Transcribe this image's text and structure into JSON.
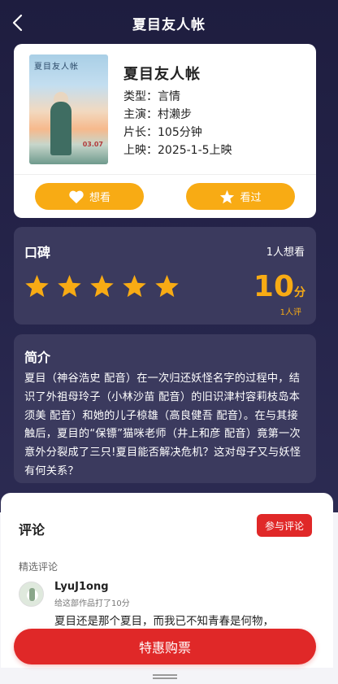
{
  "header": {
    "title": "夏目友人帐"
  },
  "movie": {
    "poster_title": "夏目友人帐",
    "poster_date": "03.07",
    "name": "夏目友人帐",
    "genre": "类型：言情",
    "cast": "主演：村濑步",
    "duration": "片长：105分钟",
    "release": "上映：2025-1-5上映"
  },
  "actions": {
    "want_label": "想看",
    "seen_label": "看过"
  },
  "rating": {
    "label": "口碑",
    "want_count": "1人想看",
    "stars_filled": 5,
    "stars_total": 5,
    "score": "10",
    "score_unit": "分",
    "rater_count": "1人评"
  },
  "intro": {
    "title": "简介",
    "text": "夏目（神谷浩史 配音）在一次归还妖怪名字的过程中，结识了外祖母玲子（小林沙苗 配音）的旧识津村容莉枝岛本须美 配音）和她的儿子椋雄（高良健吾 配音）。在与其接触后，夏目的“保镖”猫咪老师（井上和彦 配音）竟第一次意外分裂成了三只!夏目能否解决危机？这对母子又与妖怪有何关系？"
  },
  "comments": {
    "heading": "评论",
    "join_label": "参与评论",
    "selected_label": "精选评论",
    "items": [
      {
        "user": "LyuJ1ong",
        "meta": "给这部作品打了10分",
        "body": "夏目还是那个夏目，而我已不知青春是何物，"
      }
    ]
  },
  "buy": {
    "label": "特惠购票"
  },
  "colors": {
    "accent": "#f8ab14",
    "danger": "#e02828",
    "dark_card": "#3b3a5e"
  },
  "icons": {
    "back": "chevron-left-icon",
    "want": "heart-icon",
    "seen": "star-icon"
  }
}
